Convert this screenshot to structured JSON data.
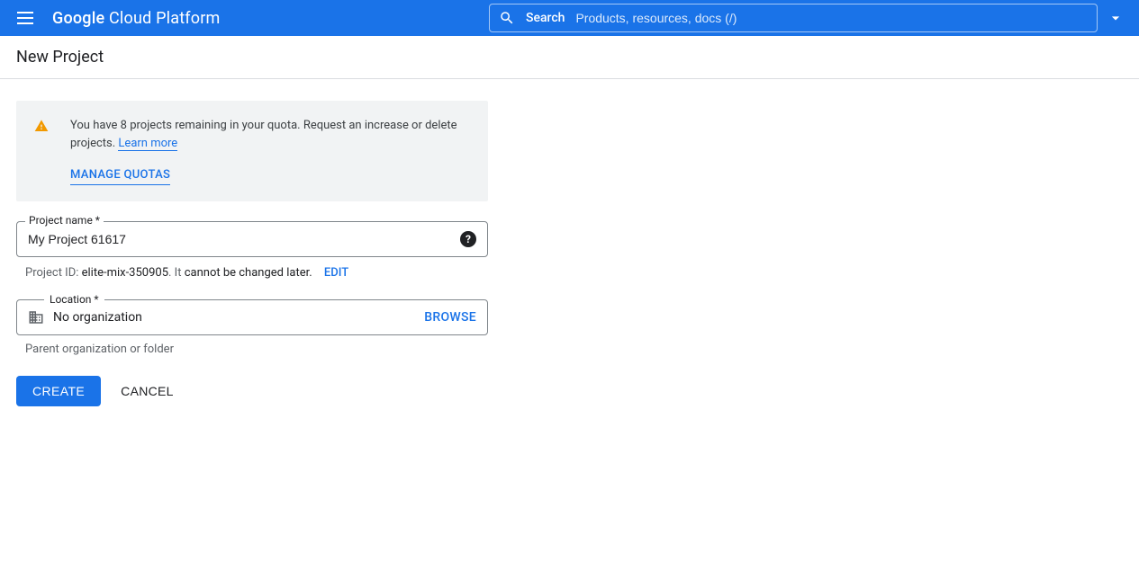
{
  "header": {
    "brand_google": "Google",
    "brand_rest": " Cloud Platform",
    "search_label": "Search",
    "search_placeholder": "Products, resources, docs (/)"
  },
  "page": {
    "title": "New Project"
  },
  "notice": {
    "text_a": "You have 8 projects remaining in your quota. Request an increase or delete projects. ",
    "learn_more": "Learn more",
    "manage_quotas": "MANAGE QUOTAS"
  },
  "project_name": {
    "label": "Project name *",
    "value": "My Project 61617"
  },
  "project_id": {
    "prefix": "Project ID: ",
    "id": "elite-mix-350905",
    "mid": ". It ",
    "nochange": "cannot be changed later.",
    "edit": "EDIT"
  },
  "location": {
    "label": "Location *",
    "value": "No organization",
    "browse": "BROWSE",
    "hint": "Parent organization or folder"
  },
  "actions": {
    "create": "CREATE",
    "cancel": "CANCEL"
  }
}
